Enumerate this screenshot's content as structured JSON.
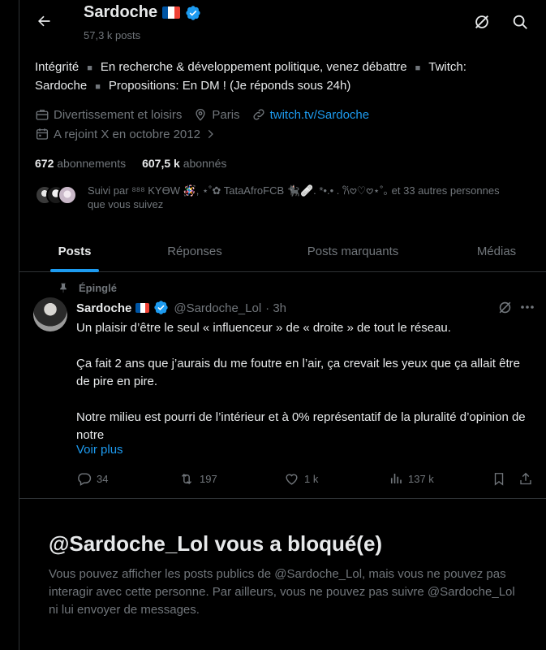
{
  "header": {
    "back_label": "Retour",
    "name": "Sardoche",
    "posts_count": "57,3 k posts"
  },
  "bio": {
    "parts": [
      "Intégrité",
      "En recherche & développement politique, venez débattre",
      "Twitch: Sardoche",
      "Propositions: En DM ! (Je réponds sous 24h)"
    ],
    "separator": "■"
  },
  "meta": {
    "category": "Divertissement et loisirs",
    "location": "Paris",
    "website": "twitch.tv/Sardoche",
    "joined": "A rejoint X en octobre 2012"
  },
  "follows": {
    "following_count": "672",
    "following_label": "abonnements",
    "followers_count": "607,5 k",
    "followers_label": "abonnés"
  },
  "followed_by": {
    "text": "Suivi par ⁸⁸⁸ KYƟW 🪅, ⋆˚✿ TataAfroFCB 🐈‍⬛🩹. *•.• . 𐙚𖹭♡𖹭⋆˚｡ et 33 autres personnes que vous suivez"
  },
  "tabs": [
    {
      "label": "Posts",
      "active": true
    },
    {
      "label": "Réponses",
      "active": false
    },
    {
      "label": "Posts marquants",
      "active": false
    },
    {
      "label": "Médias",
      "active": false
    }
  ],
  "tweet": {
    "pinned_label": "Épinglé",
    "name": "Sardoche",
    "handle": "@Sardoche_Lol",
    "time": "· 3h",
    "paragraphs": [
      "Un plaisir d’être le seul « influenceur » de « droite » de tout le réseau.",
      "Ça fait 2 ans que j’aurais du me foutre en l’air, ça crevait les yeux que ça allait être de pire en pire.",
      "Notre milieu est pourri de l’intérieur et à 0% représentatif de la pluralité d’opinion de notre"
    ],
    "more_label": "Voir plus",
    "replies": "34",
    "reposts": "197",
    "likes": "1 k",
    "views": "137 k"
  },
  "blocked": {
    "title": "@Sardoche_Lol vous a bloqué(e)",
    "text": "Vous pouvez afficher les posts publics de @Sardoche_Lol, mais vous ne pouvez pas interagir avec cette personne. Par ailleurs, vous ne pouvez pas suivre @Sardoche_Lol ni lui envoyer de messages."
  },
  "colors": {
    "background": "#000000",
    "accent": "#1d9bf0",
    "text": "#e7e9ea",
    "muted": "#71767b",
    "border": "#2f3336"
  },
  "icons": [
    "back-arrow-icon",
    "grok-icon",
    "search-icon",
    "briefcase-icon",
    "location-pin-icon",
    "link-icon",
    "calendar-icon",
    "chevron-right-icon",
    "pin-icon",
    "verified-badge-icon",
    "more-icon",
    "reply-icon",
    "repost-icon",
    "like-icon",
    "views-icon",
    "bookmark-icon",
    "share-icon"
  ]
}
